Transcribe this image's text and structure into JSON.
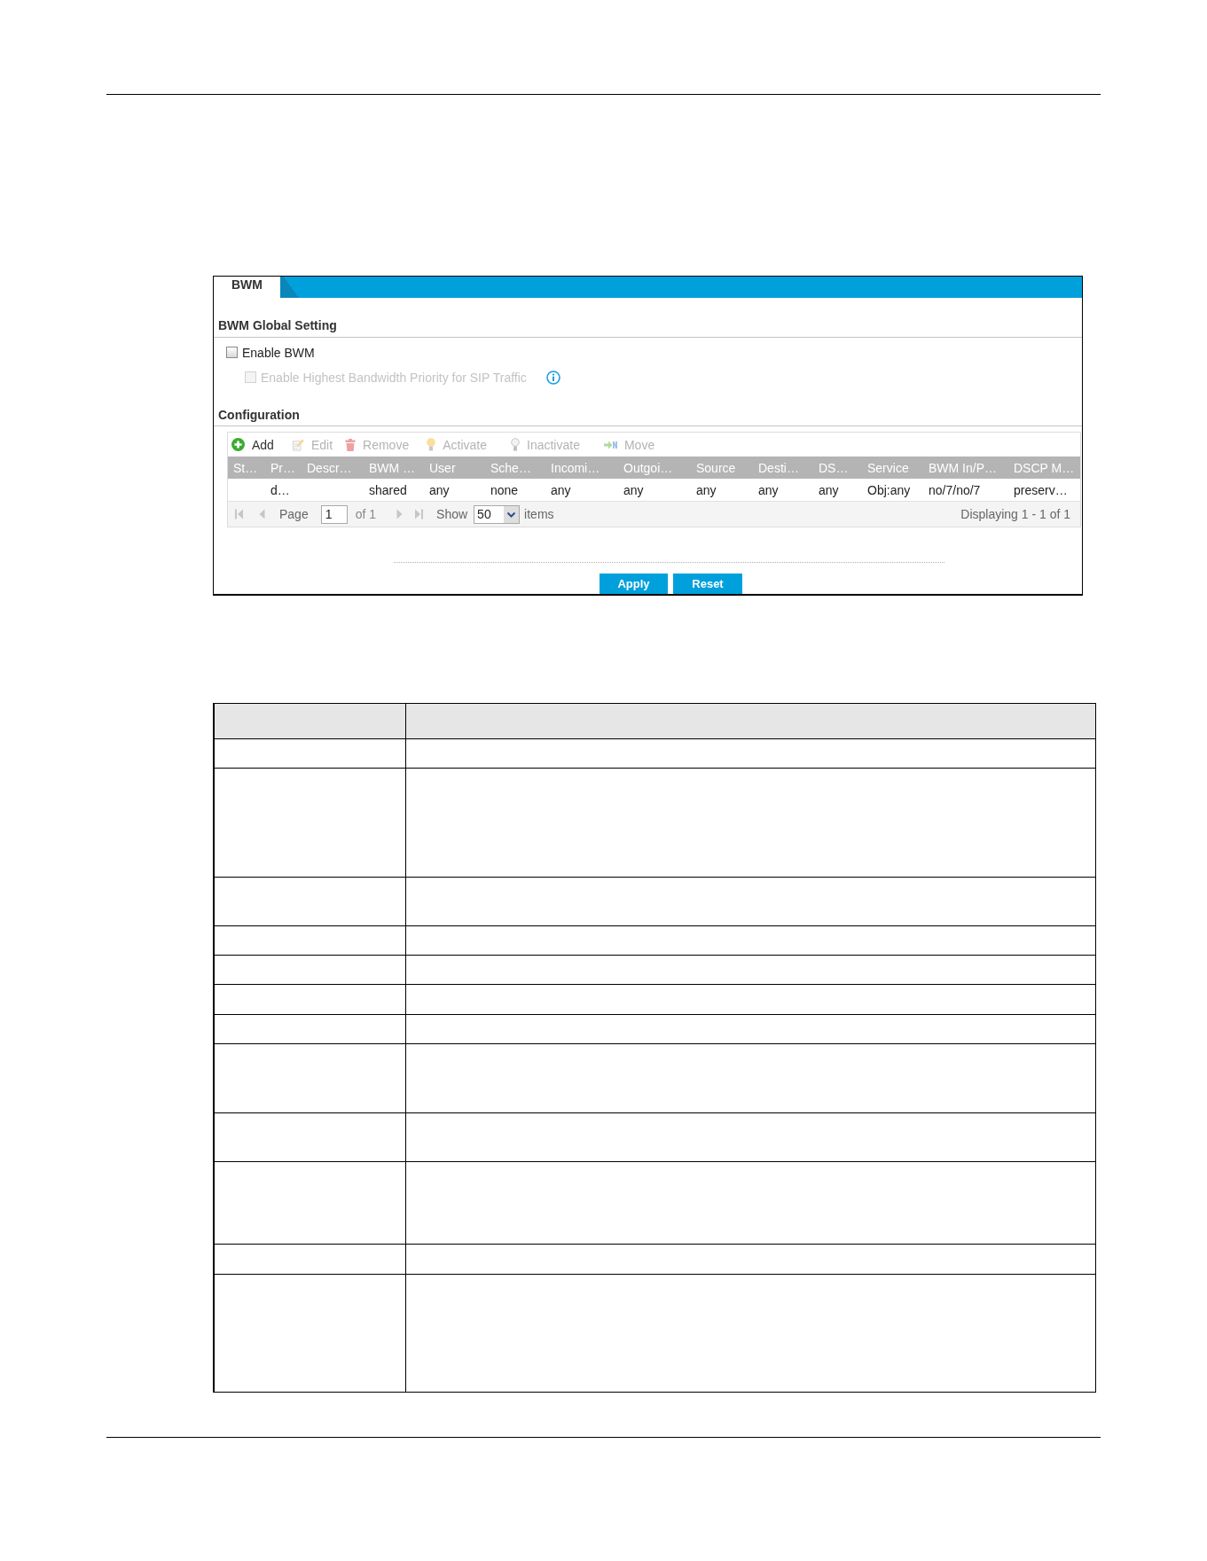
{
  "tab": {
    "label": "BWM"
  },
  "global_setting": {
    "title": "BWM Global Setting",
    "options": [
      {
        "label": "Enable BWM",
        "checked": false,
        "disabled": false,
        "children": [
          {
            "label": "Enable Highest Bandwidth Priority for SIP Traffic",
            "checked": false,
            "disabled": true,
            "info": true
          }
        ]
      }
    ]
  },
  "configuration": {
    "title": "Configuration",
    "toolbar": [
      {
        "kind": "add",
        "label": "Add",
        "disabled": false
      },
      {
        "kind": "edit",
        "label": "Edit",
        "disabled": true
      },
      {
        "kind": "remove",
        "label": "Remove",
        "disabled": true
      },
      {
        "kind": "activate",
        "label": "Activate",
        "disabled": true
      },
      {
        "kind": "inactivate",
        "label": "Inactivate",
        "disabled": true
      },
      {
        "kind": "move",
        "label": "Move",
        "disabled": true
      }
    ],
    "columns": [
      "St…",
      "Pr…",
      "Descr…",
      "BWM …",
      "User",
      "Sche…",
      "Incomi…",
      "Outgoi…",
      "Source",
      "Desti…",
      "DS…",
      "Service",
      "BWM In/P…",
      "DSCP M…"
    ],
    "rows": [
      {
        "selected": false,
        "cells": [
          null,
          "d…",
          null,
          "shared",
          "any",
          "none",
          "any",
          "any",
          "any",
          "any",
          "any",
          "Obj:any",
          "no/7/no/7",
          "preserv…"
        ]
      }
    ],
    "pager": {
      "nav": [
        {
          "kind": "first",
          "disabled": true
        },
        {
          "kind": "prev",
          "disabled": true
        },
        {
          "kind": "next",
          "disabled": true
        },
        {
          "kind": "last",
          "disabled": true
        }
      ],
      "page_label": "Page",
      "page": "1",
      "page_count": "of 1",
      "show_label": "Show",
      "page_size": "50",
      "items_label": "items",
      "summary": "Displaying 1 - 1 of 1"
    }
  },
  "buttons": [
    {
      "label": "Apply"
    },
    {
      "label": "Reset"
    }
  ]
}
